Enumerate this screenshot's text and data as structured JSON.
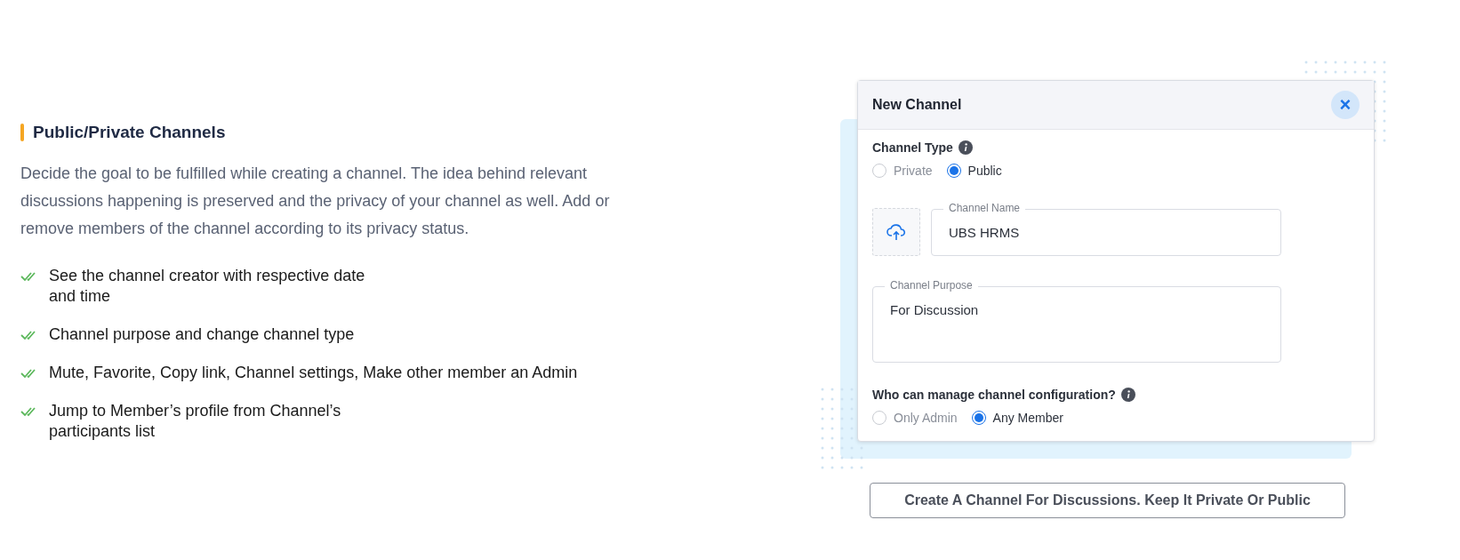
{
  "section": {
    "heading": "Public/Private Channels",
    "description": "Decide the goal to be fulfilled while creating a channel. The idea behind relevant discussions happening is preserved and the privacy of your channel as well. Add or remove members of the channel according to its privacy status.",
    "features": [
      "See the channel creator with respective date and time",
      "Channel purpose and change channel type",
      "Mute, Favorite, Copy link, Channel settings, Make other member an Admin",
      "Jump to Member’s profile from Channel’s participants list"
    ]
  },
  "dialog": {
    "title": "New Channel",
    "close": "×",
    "channel_type_label": "Channel Type",
    "channel_type_options": [
      {
        "label": "Private",
        "selected": false
      },
      {
        "label": "Public",
        "selected": true
      }
    ],
    "channel_name": {
      "label": "Channel Name",
      "value": "UBS HRMS"
    },
    "channel_purpose": {
      "label": "Channel Purpose",
      "value": "For Discussion"
    },
    "manage_label": "Who can manage channel configuration?",
    "manage_options": [
      {
        "label": "Only Admin",
        "selected": false
      },
      {
        "label": "Any Member",
        "selected": true
      }
    ]
  },
  "caption_button": "Create A Channel For Discussions. Keep It Private Or Public"
}
